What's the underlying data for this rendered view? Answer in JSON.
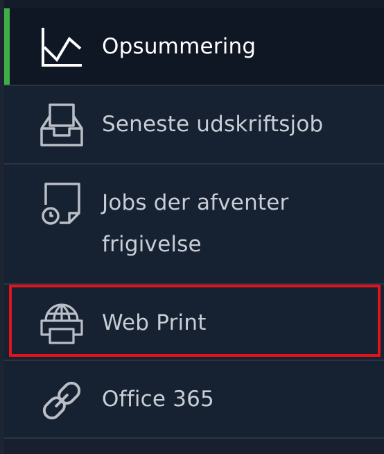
{
  "sidebar": {
    "items": [
      {
        "label": "Opsummering",
        "icon": "chart-line-icon",
        "active": true
      },
      {
        "label": "Seneste udskriftsjob",
        "icon": "inbox-tray-icon",
        "active": false
      },
      {
        "label_line1": "Jobs der afventer",
        "label_line2": "frigivelse",
        "icon": "document-clock-icon",
        "active": false
      },
      {
        "label": "Web Print",
        "icon": "globe-printer-icon",
        "active": false,
        "highlighted": true
      },
      {
        "label": "Office 365",
        "icon": "link-icon",
        "active": false
      }
    ],
    "active_color": "#3fae49",
    "highlight_color": "#e3121b"
  }
}
